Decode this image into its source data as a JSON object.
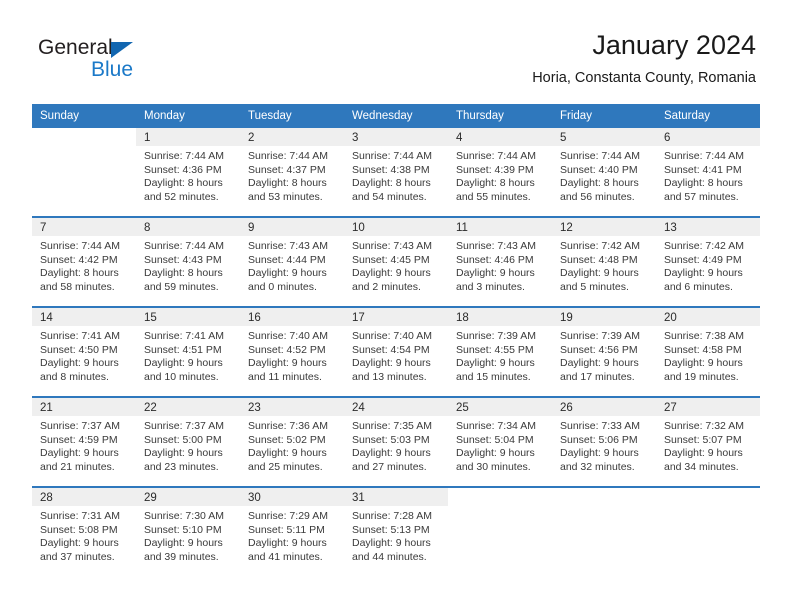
{
  "brand": {
    "name_part1": "General",
    "name_part2": "Blue",
    "logo_icon": "blue-triangle-icon"
  },
  "header": {
    "title": "January 2024",
    "subtitle": "Horia, Constanta County, Romania"
  },
  "colors": {
    "header_blue": "#2f78bd",
    "logo_blue": "#1b79c8",
    "daynum_band": "#efefef",
    "text": "#3a3a3a"
  },
  "weekday_headers": [
    "Sunday",
    "Monday",
    "Tuesday",
    "Wednesday",
    "Thursday",
    "Friday",
    "Saturday"
  ],
  "weeks": [
    [
      {
        "day": "",
        "lines": []
      },
      {
        "day": "1",
        "lines": [
          "Sunrise: 7:44 AM",
          "Sunset: 4:36 PM",
          "Daylight: 8 hours",
          "and 52 minutes."
        ]
      },
      {
        "day": "2",
        "lines": [
          "Sunrise: 7:44 AM",
          "Sunset: 4:37 PM",
          "Daylight: 8 hours",
          "and 53 minutes."
        ]
      },
      {
        "day": "3",
        "lines": [
          "Sunrise: 7:44 AM",
          "Sunset: 4:38 PM",
          "Daylight: 8 hours",
          "and 54 minutes."
        ]
      },
      {
        "day": "4",
        "lines": [
          "Sunrise: 7:44 AM",
          "Sunset: 4:39 PM",
          "Daylight: 8 hours",
          "and 55 minutes."
        ]
      },
      {
        "day": "5",
        "lines": [
          "Sunrise: 7:44 AM",
          "Sunset: 4:40 PM",
          "Daylight: 8 hours",
          "and 56 minutes."
        ]
      },
      {
        "day": "6",
        "lines": [
          "Sunrise: 7:44 AM",
          "Sunset: 4:41 PM",
          "Daylight: 8 hours",
          "and 57 minutes."
        ]
      }
    ],
    [
      {
        "day": "7",
        "lines": [
          "Sunrise: 7:44 AM",
          "Sunset: 4:42 PM",
          "Daylight: 8 hours",
          "and 58 minutes."
        ]
      },
      {
        "day": "8",
        "lines": [
          "Sunrise: 7:44 AM",
          "Sunset: 4:43 PM",
          "Daylight: 8 hours",
          "and 59 minutes."
        ]
      },
      {
        "day": "9",
        "lines": [
          "Sunrise: 7:43 AM",
          "Sunset: 4:44 PM",
          "Daylight: 9 hours",
          "and 0 minutes."
        ]
      },
      {
        "day": "10",
        "lines": [
          "Sunrise: 7:43 AM",
          "Sunset: 4:45 PM",
          "Daylight: 9 hours",
          "and 2 minutes."
        ]
      },
      {
        "day": "11",
        "lines": [
          "Sunrise: 7:43 AM",
          "Sunset: 4:46 PM",
          "Daylight: 9 hours",
          "and 3 minutes."
        ]
      },
      {
        "day": "12",
        "lines": [
          "Sunrise: 7:42 AM",
          "Sunset: 4:48 PM",
          "Daylight: 9 hours",
          "and 5 minutes."
        ]
      },
      {
        "day": "13",
        "lines": [
          "Sunrise: 7:42 AM",
          "Sunset: 4:49 PM",
          "Daylight: 9 hours",
          "and 6 minutes."
        ]
      }
    ],
    [
      {
        "day": "14",
        "lines": [
          "Sunrise: 7:41 AM",
          "Sunset: 4:50 PM",
          "Daylight: 9 hours",
          "and 8 minutes."
        ]
      },
      {
        "day": "15",
        "lines": [
          "Sunrise: 7:41 AM",
          "Sunset: 4:51 PM",
          "Daylight: 9 hours",
          "and 10 minutes."
        ]
      },
      {
        "day": "16",
        "lines": [
          "Sunrise: 7:40 AM",
          "Sunset: 4:52 PM",
          "Daylight: 9 hours",
          "and 11 minutes."
        ]
      },
      {
        "day": "17",
        "lines": [
          "Sunrise: 7:40 AM",
          "Sunset: 4:54 PM",
          "Daylight: 9 hours",
          "and 13 minutes."
        ]
      },
      {
        "day": "18",
        "lines": [
          "Sunrise: 7:39 AM",
          "Sunset: 4:55 PM",
          "Daylight: 9 hours",
          "and 15 minutes."
        ]
      },
      {
        "day": "19",
        "lines": [
          "Sunrise: 7:39 AM",
          "Sunset: 4:56 PM",
          "Daylight: 9 hours",
          "and 17 minutes."
        ]
      },
      {
        "day": "20",
        "lines": [
          "Sunrise: 7:38 AM",
          "Sunset: 4:58 PM",
          "Daylight: 9 hours",
          "and 19 minutes."
        ]
      }
    ],
    [
      {
        "day": "21",
        "lines": [
          "Sunrise: 7:37 AM",
          "Sunset: 4:59 PM",
          "Daylight: 9 hours",
          "and 21 minutes."
        ]
      },
      {
        "day": "22",
        "lines": [
          "Sunrise: 7:37 AM",
          "Sunset: 5:00 PM",
          "Daylight: 9 hours",
          "and 23 minutes."
        ]
      },
      {
        "day": "23",
        "lines": [
          "Sunrise: 7:36 AM",
          "Sunset: 5:02 PM",
          "Daylight: 9 hours",
          "and 25 minutes."
        ]
      },
      {
        "day": "24",
        "lines": [
          "Sunrise: 7:35 AM",
          "Sunset: 5:03 PM",
          "Daylight: 9 hours",
          "and 27 minutes."
        ]
      },
      {
        "day": "25",
        "lines": [
          "Sunrise: 7:34 AM",
          "Sunset: 5:04 PM",
          "Daylight: 9 hours",
          "and 30 minutes."
        ]
      },
      {
        "day": "26",
        "lines": [
          "Sunrise: 7:33 AM",
          "Sunset: 5:06 PM",
          "Daylight: 9 hours",
          "and 32 minutes."
        ]
      },
      {
        "day": "27",
        "lines": [
          "Sunrise: 7:32 AM",
          "Sunset: 5:07 PM",
          "Daylight: 9 hours",
          "and 34 minutes."
        ]
      }
    ],
    [
      {
        "day": "28",
        "lines": [
          "Sunrise: 7:31 AM",
          "Sunset: 5:08 PM",
          "Daylight: 9 hours",
          "and 37 minutes."
        ]
      },
      {
        "day": "29",
        "lines": [
          "Sunrise: 7:30 AM",
          "Sunset: 5:10 PM",
          "Daylight: 9 hours",
          "and 39 minutes."
        ]
      },
      {
        "day": "30",
        "lines": [
          "Sunrise: 7:29 AM",
          "Sunset: 5:11 PM",
          "Daylight: 9 hours",
          "and 41 minutes."
        ]
      },
      {
        "day": "31",
        "lines": [
          "Sunrise: 7:28 AM",
          "Sunset: 5:13 PM",
          "Daylight: 9 hours",
          "and 44 minutes."
        ]
      },
      {
        "day": "",
        "lines": []
      },
      {
        "day": "",
        "lines": []
      },
      {
        "day": "",
        "lines": []
      }
    ]
  ]
}
